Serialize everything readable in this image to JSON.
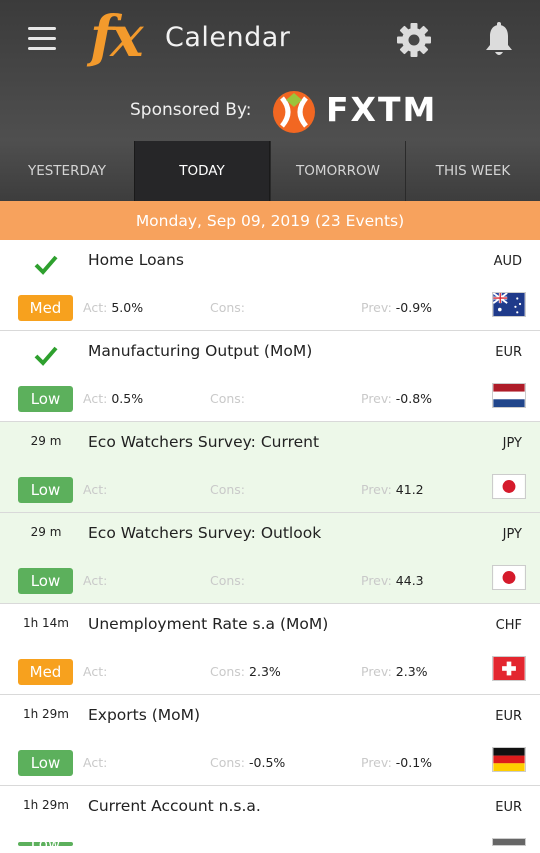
{
  "header": {
    "logo_text": "fx",
    "title": "Calendar",
    "sponsored_label": "Sponsored By:",
    "sponsor_name": "FXTM",
    "icons": [
      "menu-icon",
      "gear-icon",
      "bell-icon"
    ]
  },
  "tabs": [
    {
      "label": "YESTERDAY",
      "active": false
    },
    {
      "label": "TODAY",
      "active": true
    },
    {
      "label": "TOMORROW",
      "active": false
    },
    {
      "label": "THIS WEEK",
      "active": false
    }
  ],
  "date_banner": "Monday, Sep 09, 2019 (23 Events)",
  "labels": {
    "actual": "Act:",
    "consensus": "Cons:",
    "previous": "Prev:"
  },
  "events": [
    {
      "time": "",
      "done": true,
      "name": "Home Loans",
      "currency": "AUD",
      "impact": "Med",
      "actual": "5.0%",
      "consensus": "",
      "previous": "-0.9%",
      "flag": "australia",
      "highlight": false
    },
    {
      "time": "",
      "done": true,
      "name": "Manufacturing Output (MoM)",
      "currency": "EUR",
      "impact": "Low",
      "actual": "0.5%",
      "consensus": "",
      "previous": "-0.8%",
      "flag": "netherlands",
      "highlight": false
    },
    {
      "time": "29 m",
      "done": false,
      "name": "Eco Watchers Survey: Current",
      "currency": "JPY",
      "impact": "Low",
      "actual": "",
      "consensus": "",
      "previous": "41.2",
      "flag": "japan",
      "highlight": true
    },
    {
      "time": "29 m",
      "done": false,
      "name": "Eco Watchers Survey: Outlook",
      "currency": "JPY",
      "impact": "Low",
      "actual": "",
      "consensus": "",
      "previous": "44.3",
      "flag": "japan",
      "highlight": true
    },
    {
      "time": "1h 14m",
      "done": false,
      "name": "Unemployment Rate s.a (MoM)",
      "currency": "CHF",
      "impact": "Med",
      "actual": "",
      "consensus": "2.3%",
      "previous": "2.3%",
      "flag": "switzerland",
      "highlight": false
    },
    {
      "time": "1h 29m",
      "done": false,
      "name": "Exports (MoM)",
      "currency": "EUR",
      "impact": "Low",
      "actual": "",
      "consensus": "-0.5%",
      "previous": "-0.1%",
      "flag": "germany",
      "highlight": false
    },
    {
      "time": "1h 29m",
      "done": false,
      "name": "Current Account n.s.a.",
      "currency": "EUR",
      "impact": "Low",
      "actual": "",
      "consensus": "",
      "previous": "",
      "flag": "germany",
      "highlight": false
    }
  ],
  "colors": {
    "accent": "#f39a2c",
    "date_band": "#f7a25d",
    "impact_med": "#f7a11e",
    "impact_low": "#5cb05c",
    "check": "#2ea02e",
    "highlight_row": "#edf8e9"
  }
}
